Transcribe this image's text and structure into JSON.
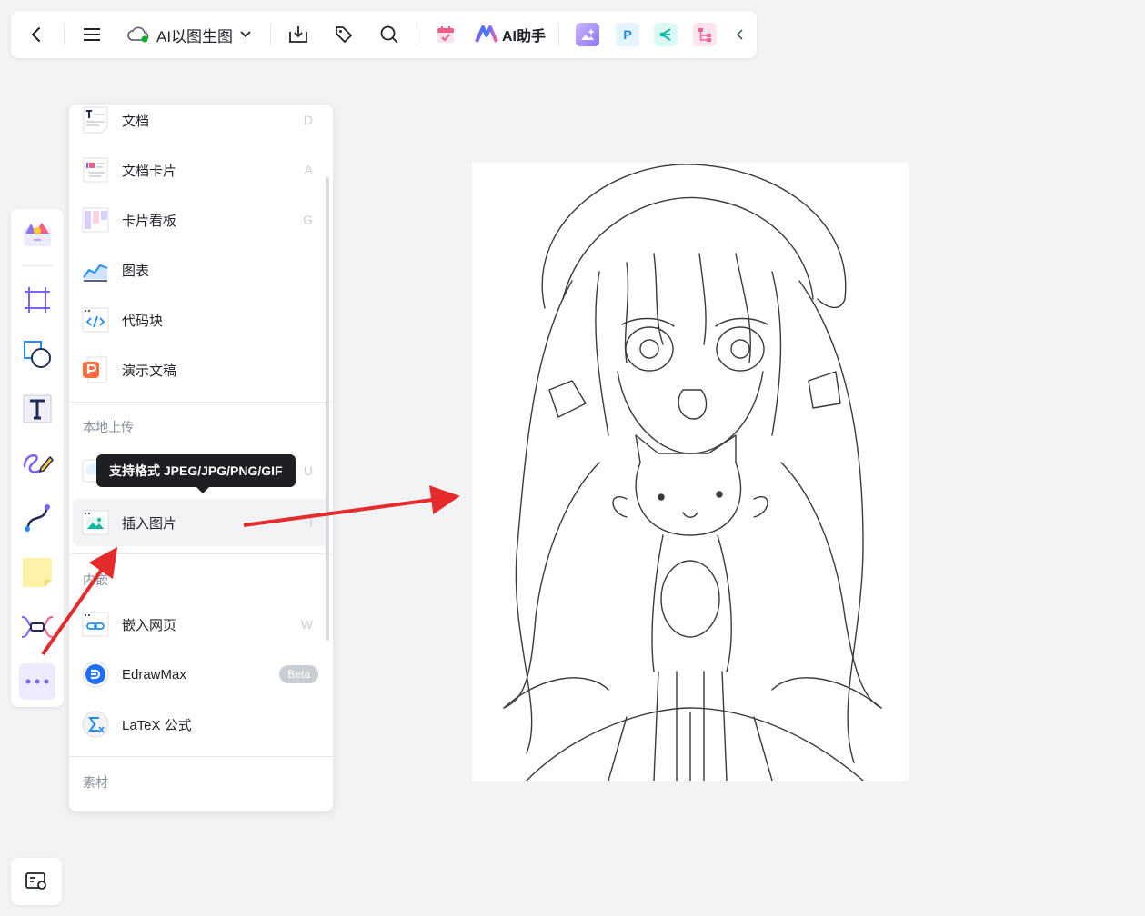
{
  "toolbar": {
    "back_icon": "chevron-left-icon",
    "menu_icon": "hamburger-icon",
    "doc_status_icon": "cloud-synced-icon",
    "doc_title": "AI以图生图",
    "ai_assistant_label": "AI助手",
    "apps": [
      "image-gen-app",
      "P",
      "mindmap-app",
      "org-chart-app"
    ]
  },
  "left_toolbar": {
    "tools": [
      "template-icon",
      "frame-icon",
      "shape-icon",
      "text-icon",
      "pen-icon",
      "connector-icon",
      "sticky-note-icon",
      "mindmap-icon",
      "more-icon"
    ]
  },
  "insert_menu": {
    "items_top": [
      {
        "label": "文档",
        "key": "D"
      },
      {
        "label": "文档卡片",
        "key": "A"
      },
      {
        "label": "卡片看板",
        "key": "G"
      },
      {
        "label": "图表",
        "key": ""
      },
      {
        "label": "代码块",
        "key": ""
      },
      {
        "label": "演示文稿",
        "key": ""
      }
    ],
    "section_local": "本地上传",
    "upload_key": "U",
    "insert_image": {
      "label": "插入图片",
      "key": "I"
    },
    "section_embed": "内嵌",
    "items_embed": [
      {
        "label": "嵌入网页",
        "key": "W"
      },
      {
        "label": "EdrawMax",
        "badge": "Beta"
      },
      {
        "label": "LaTeX 公式",
        "key": ""
      }
    ],
    "section_material": "素材"
  },
  "tooltip": {
    "text": "支持格式 JPEG/JPG/PNG/GIF"
  },
  "colors": {
    "accent": "#7b61ff",
    "arrow": "#e52b2b",
    "tooltip_bg": "#1d1f23"
  }
}
